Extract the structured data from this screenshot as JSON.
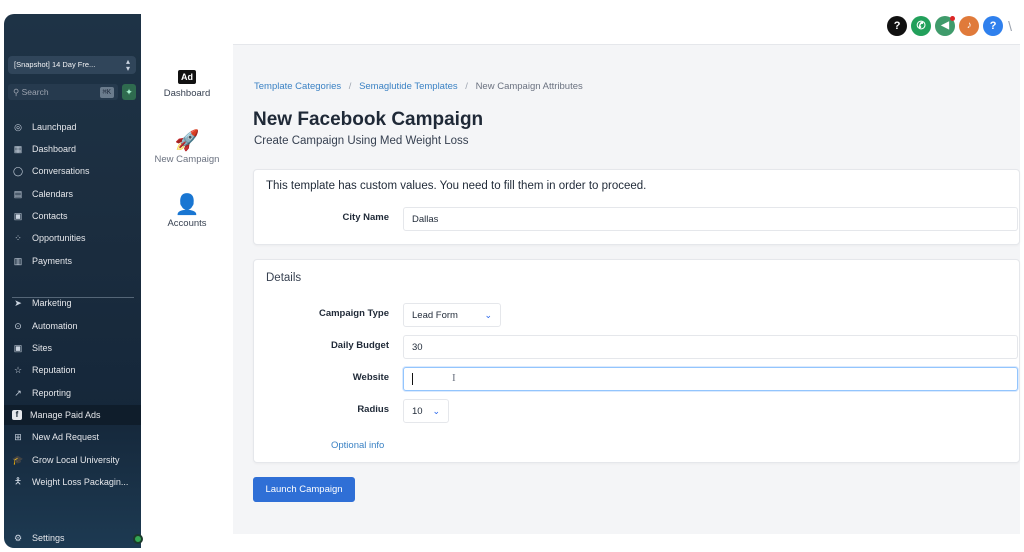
{
  "sidebar": {
    "snapshot_label": "[Snapshot] 14 Day Fre...",
    "search_placeholder": "Search",
    "search_shortcut": "⌘K",
    "items": [
      {
        "label": "Launchpad",
        "icon": "rocket-icon"
      },
      {
        "label": "Dashboard",
        "icon": "dashboard-icon"
      },
      {
        "label": "Conversations",
        "icon": "chat-icon"
      },
      {
        "label": "Calendars",
        "icon": "calendar-icon"
      },
      {
        "label": "Contacts",
        "icon": "contacts-icon"
      },
      {
        "label": "Opportunities",
        "icon": "opportunities-icon"
      },
      {
        "label": "Payments",
        "icon": "payments-icon"
      },
      {
        "label": "Marketing",
        "icon": "send-icon"
      },
      {
        "label": "Automation",
        "icon": "automation-icon"
      },
      {
        "label": "Sites",
        "icon": "sites-icon"
      },
      {
        "label": "Reputation",
        "icon": "star-icon"
      },
      {
        "label": "Reporting",
        "icon": "chart-icon"
      },
      {
        "label": "Manage Paid Ads",
        "icon": "facebook-icon"
      },
      {
        "label": "New Ad Request",
        "icon": "plus-square-icon"
      },
      {
        "label": "Grow Local University",
        "icon": "graduation-icon"
      },
      {
        "label": "Weight Loss Packagin...",
        "icon": "person-icon"
      }
    ],
    "settings_label": "Settings"
  },
  "apps": {
    "ad_badge": "Ad",
    "dashboard_label": "Dashboard",
    "new_campaign_label": "New Campaign",
    "accounts_label": "Accounts"
  },
  "breadcrumb": {
    "item1": "Template Categories",
    "item2": "Semaglutide Templates",
    "item3": "New Campaign Attributes",
    "sep": "/"
  },
  "page": {
    "title": "New Facebook Campaign",
    "subtitle": "Create Campaign Using Med Weight Loss"
  },
  "custom_values": {
    "notice": "This template has custom values. You need to fill them in order to proceed.",
    "city_label": "City Name",
    "city_value": "Dallas"
  },
  "details": {
    "heading": "Details",
    "campaign_type_label": "Campaign Type",
    "campaign_type_value": "Lead Form",
    "daily_budget_label": "Daily Budget",
    "daily_budget_value": "30",
    "website_label": "Website",
    "website_value": "",
    "radius_label": "Radius",
    "radius_value": "10",
    "optional_link": "Optional info"
  },
  "actions": {
    "launch_label": "Launch Campaign"
  },
  "top_icons": [
    {
      "name": "help-icon",
      "glyph": "?",
      "color": "#111111"
    },
    {
      "name": "phone-icon",
      "glyph": "✆",
      "color": "#22a05b"
    },
    {
      "name": "megaphone-icon",
      "glyph": "📢",
      "color": "#3f9b6b"
    },
    {
      "name": "bell-icon",
      "glyph": "🔔",
      "color": "#e07a3a"
    },
    {
      "name": "question-icon",
      "glyph": "?",
      "color": "#2f80ed"
    }
  ]
}
